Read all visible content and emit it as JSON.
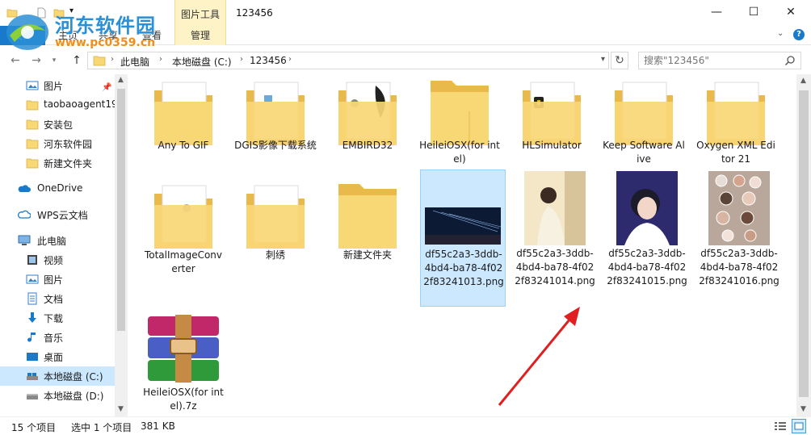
{
  "window": {
    "title": "123456",
    "context_tab_header": "图片工具",
    "controls": {
      "minimize": "—",
      "maximize": "☐",
      "close": "✕"
    }
  },
  "ribbon": {
    "file_tab": "文件",
    "tabs": [
      "主页",
      "共享",
      "查看",
      "管理"
    ],
    "collapse": "⌄",
    "help": "?"
  },
  "watermark": {
    "title": "河东软件园",
    "url": "www.pc0359.cn"
  },
  "address": {
    "crumbs": [
      "此电脑",
      "本地磁盘 (C:)",
      "123456"
    ],
    "search_placeholder": "搜索\"123456\""
  },
  "nav_pane": {
    "items": [
      {
        "label": "图片",
        "icon": "pictures-icon",
        "pinned": true
      },
      {
        "label": "taobaoagent19",
        "icon": "folder-icon"
      },
      {
        "label": "安装包",
        "icon": "folder-icon"
      },
      {
        "label": "河东软件园",
        "icon": "folder-icon"
      },
      {
        "label": "新建文件夹",
        "icon": "folder-icon"
      },
      {
        "label": "OneDrive",
        "icon": "onedrive-icon"
      },
      {
        "label": "WPS云文档",
        "icon": "wps-cloud-icon"
      },
      {
        "label": "此电脑",
        "icon": "this-pc-icon"
      },
      {
        "label": "视频",
        "icon": "videos-icon"
      },
      {
        "label": "图片",
        "icon": "pictures-icon"
      },
      {
        "label": "文档",
        "icon": "documents-icon"
      },
      {
        "label": "下载",
        "icon": "downloads-icon"
      },
      {
        "label": "音乐",
        "icon": "music-icon"
      },
      {
        "label": "桌面",
        "icon": "desktop-icon"
      },
      {
        "label": "本地磁盘 (C:)",
        "icon": "drive-icon",
        "selected": true
      },
      {
        "label": "本地磁盘 (D:)",
        "icon": "drive-icon"
      }
    ]
  },
  "files": [
    {
      "name": "Any To GIF",
      "type": "folder"
    },
    {
      "name": "DGIS影像下载系统",
      "type": "folder"
    },
    {
      "name": "EMBIRD32",
      "type": "folder"
    },
    {
      "name": "HeileiOSX(for intel)",
      "type": "folder"
    },
    {
      "name": "HLSimulator",
      "type": "folder"
    },
    {
      "name": "Keep Software Alive",
      "type": "folder"
    },
    {
      "name": "Oxygen XML Editor 21",
      "type": "folder"
    },
    {
      "name": "TotalImageConverter",
      "type": "folder"
    },
    {
      "name": "刺绣",
      "type": "folder"
    },
    {
      "name": "新建文件夹",
      "type": "folder"
    },
    {
      "name": "df55c2a3-3ddb-4bd4-ba78-4f022f83241013.png",
      "type": "image",
      "selected": true
    },
    {
      "name": "df55c2a3-3ddb-4bd4-ba78-4f022f83241014.png",
      "type": "image"
    },
    {
      "name": "df55c2a3-3ddb-4bd4-ba78-4f022f83241015.png",
      "type": "image"
    },
    {
      "name": "df55c2a3-3ddb-4bd4-ba78-4f022f83241016.png",
      "type": "image"
    },
    {
      "name": "HeileiOSX(for intel).7z",
      "type": "archive"
    }
  ],
  "status": {
    "count": "15 个项目",
    "selection": "选中 1 个项目",
    "size": "381 KB"
  },
  "colors": {
    "accent": "#1979ca",
    "selection": "#cce8ff",
    "folder": "#f8d775",
    "annotation_arrow": "#e02020"
  }
}
